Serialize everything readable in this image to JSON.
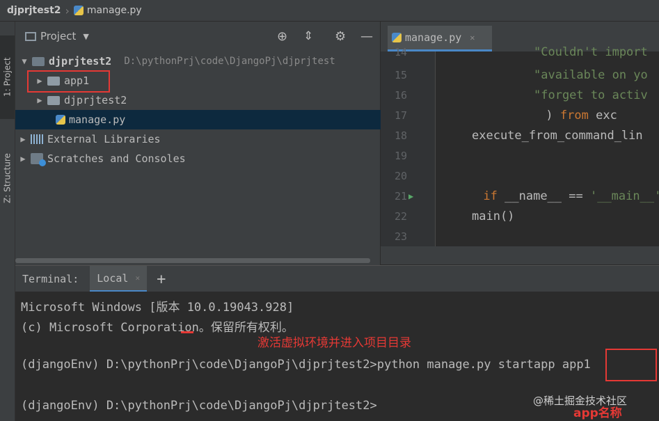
{
  "breadcrumb": {
    "project": "djprjtest2",
    "file": "manage.py"
  },
  "side_tabs": {
    "project": "1: Project",
    "structure": "Z: Structure"
  },
  "project_panel": {
    "title": "Project",
    "tree": [
      {
        "label": "djprjtest2",
        "path": "D:\\pythonPrj\\code\\DjangoPj\\djprjtest"
      },
      {
        "label": "app1"
      },
      {
        "label": "djprjtest2"
      },
      {
        "label": "manage.py"
      },
      {
        "label": "External Libraries"
      },
      {
        "label": "Scratches and Consoles"
      }
    ]
  },
  "editor": {
    "tab_label": "manage.py",
    "lines": [
      {
        "num": "14",
        "text": "\"Couldn't import"
      },
      {
        "num": "15",
        "text": "\"available on yo"
      },
      {
        "num": "16",
        "text": "\"forget to activ"
      },
      {
        "num": "17",
        "pre": ") ",
        "kw": "from",
        "post": " exc"
      },
      {
        "num": "18",
        "text": "execute_from_command_lin"
      },
      {
        "num": "19",
        "text": ""
      },
      {
        "num": "20",
        "text": ""
      },
      {
        "num": "21",
        "kw": "if",
        "post": " __name__ == ",
        "str": "'__main__'",
        "tail": ":"
      },
      {
        "num": "22",
        "text": "main()"
      },
      {
        "num": "23",
        "text": ""
      }
    ]
  },
  "terminal": {
    "title": "Terminal:",
    "tab": "Local",
    "add": "+",
    "lines": [
      "Microsoft Windows [版本 10.0.19043.928]",
      "(c) Microsoft Corporation。保留所有权利。",
      "(djangoEnv) D:\\pythonPrj\\code\\DjangoPj\\djprjtest2>python manage.py startapp app1",
      "(djangoEnv) D:\\pythonPrj\\code\\DjangoPj\\djprjtest2>"
    ],
    "annotation_1": "激活虚拟环境并进入项目目录",
    "annotation_2": "app名称",
    "watermark": "@稀土掘金技术社区"
  },
  "colors": {
    "annotation": "#e53935",
    "keyword": "#cc7832",
    "string": "#6a8759",
    "selection": "#0d293e"
  }
}
